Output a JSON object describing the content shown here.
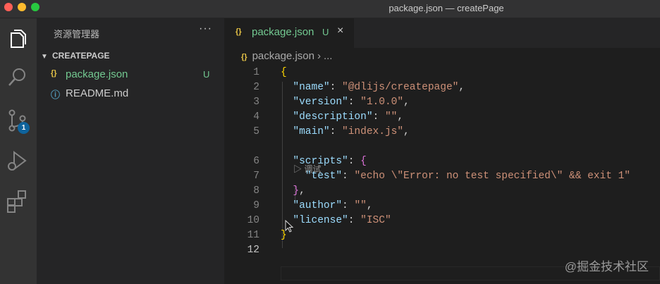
{
  "window": {
    "title": "package.json — createPage"
  },
  "activity_bar": {
    "items": [
      {
        "icon": "explorer-icon"
      },
      {
        "icon": "search-icon"
      },
      {
        "icon": "source-control-icon",
        "badge": "1"
      },
      {
        "icon": "run-debug-icon"
      },
      {
        "icon": "extensions-icon"
      }
    ]
  },
  "sidebar": {
    "title": "资源管理器",
    "more": "···",
    "section": "CREATEPAGE",
    "files": [
      {
        "name": "package.json",
        "icon": "{}",
        "status": "U",
        "color": "#73c991"
      },
      {
        "name": "README.md",
        "icon": "ⓘ",
        "status": "",
        "color": "#cccccc"
      }
    ]
  },
  "editor": {
    "tab": {
      "icon": "{}",
      "label": "package.json",
      "status": "U",
      "close": "×"
    },
    "breadcrumb": {
      "icon": "{}",
      "file": "package.json",
      "separator": "›",
      "more": "..."
    },
    "codelens": "▷ 调试",
    "lines": [
      {
        "n": "1",
        "tokens": [
          [
            "brace",
            "{"
          ]
        ]
      },
      {
        "n": "2",
        "tokens": [
          [
            "pun",
            "  "
          ],
          [
            "key",
            "\"name\""
          ],
          [
            "pun",
            ": "
          ],
          [
            "str",
            "\"@dlijs/createpage\""
          ],
          [
            "pun",
            ","
          ]
        ]
      },
      {
        "n": "3",
        "tokens": [
          [
            "pun",
            "  "
          ],
          [
            "key",
            "\"version\""
          ],
          [
            "pun",
            ": "
          ],
          [
            "str",
            "\"1.0.0\""
          ],
          [
            "pun",
            ","
          ]
        ]
      },
      {
        "n": "4",
        "tokens": [
          [
            "pun",
            "  "
          ],
          [
            "key",
            "\"description\""
          ],
          [
            "pun",
            ": "
          ],
          [
            "str",
            "\"\""
          ],
          [
            "pun",
            ","
          ]
        ]
      },
      {
        "n": "5",
        "tokens": [
          [
            "pun",
            "  "
          ],
          [
            "key",
            "\"main\""
          ],
          [
            "pun",
            ": "
          ],
          [
            "str",
            "\"index.js\""
          ],
          [
            "pun",
            ","
          ]
        ]
      },
      {
        "n": "6",
        "tokens": [
          [
            "pun",
            "  "
          ],
          [
            "key",
            "\"scripts\""
          ],
          [
            "pun",
            ": "
          ],
          [
            "brace2",
            "{"
          ]
        ]
      },
      {
        "n": "7",
        "tokens": [
          [
            "pun",
            "    "
          ],
          [
            "key",
            "\"test\""
          ],
          [
            "pun",
            ": "
          ],
          [
            "str",
            "\"echo \\\"Error: no test specified\\\" && exit 1\""
          ]
        ]
      },
      {
        "n": "8",
        "tokens": [
          [
            "pun",
            "  "
          ],
          [
            "brace2",
            "}"
          ],
          [
            "pun",
            ","
          ]
        ]
      },
      {
        "n": "9",
        "tokens": [
          [
            "pun",
            "  "
          ],
          [
            "key",
            "\"author\""
          ],
          [
            "pun",
            ": "
          ],
          [
            "str",
            "\"\""
          ],
          [
            "pun",
            ","
          ]
        ]
      },
      {
        "n": "10",
        "tokens": [
          [
            "pun",
            "  "
          ],
          [
            "key",
            "\"license\""
          ],
          [
            "pun",
            ": "
          ],
          [
            "str",
            "\"ISC\""
          ]
        ]
      },
      {
        "n": "11",
        "tokens": [
          [
            "brace",
            "}"
          ]
        ]
      },
      {
        "n": "12",
        "tokens": []
      }
    ]
  },
  "watermark": "@掘金技术社区"
}
